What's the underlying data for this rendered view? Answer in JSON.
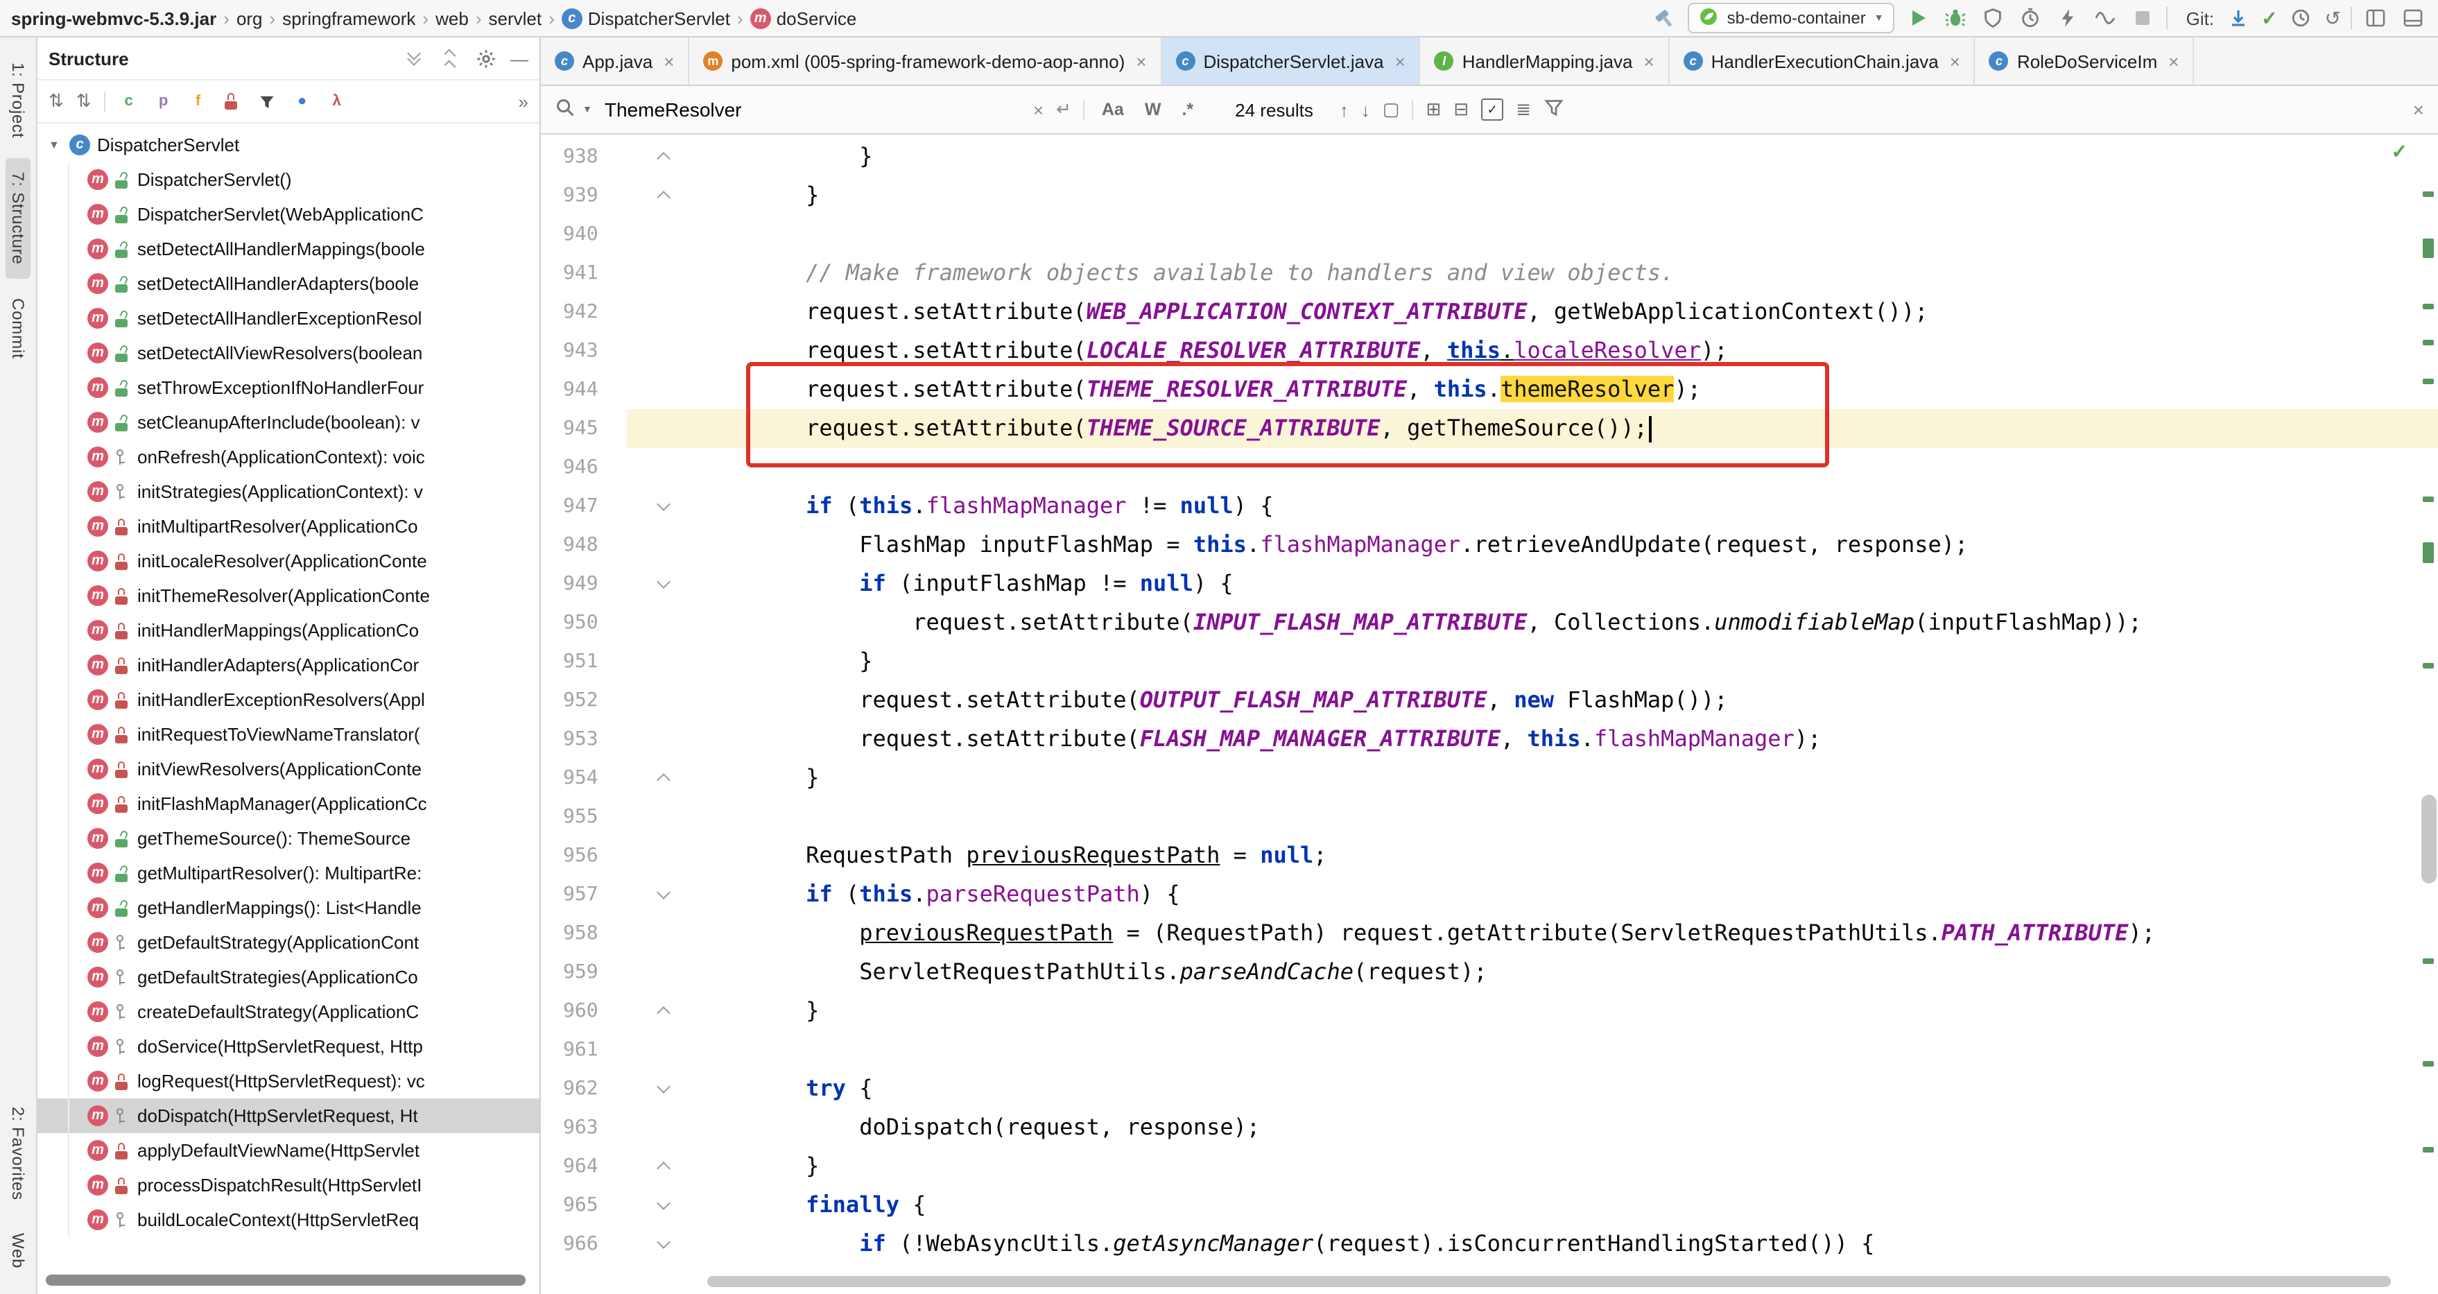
{
  "topbar": {
    "breadcrumbs": [
      {
        "label": "spring-webmvc-5.3.9.jar",
        "bold": true
      },
      {
        "label": "org"
      },
      {
        "label": "springframework"
      },
      {
        "label": "web"
      },
      {
        "label": "servlet"
      },
      {
        "label": "DispatcherServlet",
        "icon": "class"
      },
      {
        "label": "doService",
        "icon": "method"
      }
    ],
    "run_config": "sb-demo-container",
    "git_label": "Git:"
  },
  "stripe": {
    "top": [
      {
        "label": "1: Project"
      },
      {
        "label": "7: Structure",
        "active": true
      },
      {
        "label": "Commit"
      }
    ],
    "bottom": [
      {
        "label": "2: Favorites"
      },
      {
        "label": "Web"
      }
    ]
  },
  "structure": {
    "title": "Structure",
    "root": {
      "label": "DispatcherServlet"
    },
    "toolbar_chips": [
      {
        "glyph": "c",
        "color": "#59a869",
        "name": "show-anonymous-classes-toggle"
      },
      {
        "glyph": "p",
        "color": "#9876aa",
        "name": "show-properties-toggle"
      },
      {
        "glyph": "f",
        "color": "#e8a33d",
        "name": "show-fields-toggle"
      },
      {
        "type": "lock",
        "name": "show-non-public-toggle"
      },
      {
        "type": "funnel",
        "name": "group-methods-toggle"
      },
      {
        "glyph": "●",
        "color": "#3b82c4",
        "name": "sort-by-visibility-toggle"
      },
      {
        "glyph": "λ",
        "color": "#c75450",
        "name": "show-lambdas-toggle"
      }
    ],
    "items": [
      {
        "label": "DispatcherServlet()",
        "vis": "public"
      },
      {
        "label": "DispatcherServlet(WebApplicationC",
        "vis": "public"
      },
      {
        "label": "setDetectAllHandlerMappings(boole",
        "vis": "public"
      },
      {
        "label": "setDetectAllHandlerAdapters(boole",
        "vis": "public"
      },
      {
        "label": "setDetectAllHandlerExceptionResol",
        "vis": "public"
      },
      {
        "label": "setDetectAllViewResolvers(boolean",
        "vis": "public"
      },
      {
        "label": "setThrowExceptionIfNoHandlerFour",
        "vis": "public"
      },
      {
        "label": "setCleanupAfterInclude(boolean): v",
        "vis": "public"
      },
      {
        "label": "onRefresh(ApplicationContext): voic",
        "vis": "protected"
      },
      {
        "label": "initStrategies(ApplicationContext): v",
        "vis": "protected"
      },
      {
        "label": "initMultipartResolver(ApplicationCo",
        "vis": "private"
      },
      {
        "label": "initLocaleResolver(ApplicationConte",
        "vis": "private"
      },
      {
        "label": "initThemeResolver(ApplicationConte",
        "vis": "private"
      },
      {
        "label": "initHandlerMappings(ApplicationCo",
        "vis": "private"
      },
      {
        "label": "initHandlerAdapters(ApplicationCor",
        "vis": "private"
      },
      {
        "label": "initHandlerExceptionResolvers(Appl",
        "vis": "private"
      },
      {
        "label": "initRequestToViewNameTranslator(",
        "vis": "private"
      },
      {
        "label": "initViewResolvers(ApplicationConte",
        "vis": "private"
      },
      {
        "label": "initFlashMapManager(ApplicationCc",
        "vis": "private"
      },
      {
        "label": "getThemeSource(): ThemeSource",
        "vis": "public"
      },
      {
        "label": "getMultipartResolver(): MultipartRe:",
        "vis": "public"
      },
      {
        "label": "getHandlerMappings(): List<Handle",
        "vis": "public"
      },
      {
        "label": "getDefaultStrategy(ApplicationCont",
        "vis": "protected"
      },
      {
        "label": "getDefaultStrategies(ApplicationCo",
        "vis": "protected"
      },
      {
        "label": "createDefaultStrategy(ApplicationC",
        "vis": "protected"
      },
      {
        "label": "doService(HttpServletRequest, Http",
        "vis": "protected"
      },
      {
        "label": "logRequest(HttpServletRequest): vc",
        "vis": "private"
      },
      {
        "label": "doDispatch(HttpServletRequest, Ht",
        "vis": "protected",
        "selected": true
      },
      {
        "label": "applyDefaultViewName(HttpServlet",
        "vis": "private"
      },
      {
        "label": "processDispatchResult(HttpServletI",
        "vis": "private"
      },
      {
        "label": "buildLocaleContext(HttpServletReq",
        "vis": "protected"
      }
    ]
  },
  "editor": {
    "tabs": [
      {
        "label": "App.java",
        "icon": "class"
      },
      {
        "label": "pom.xml (005-spring-framework-demo-aop-anno)",
        "icon": "maven"
      },
      {
        "label": "DispatcherServlet.java",
        "icon": "class",
        "active": true
      },
      {
        "label": "HandlerMapping.java",
        "icon": "interface"
      },
      {
        "label": "HandlerExecutionChain.java",
        "icon": "class"
      },
      {
        "label": "RoleDoServiceIm",
        "icon": "class"
      }
    ],
    "find": {
      "query": "ThemeResolver",
      "results": "24 results"
    },
    "code": {
      "lines": [
        {
          "n": 938,
          "fold": "up",
          "seg": [
            [
              "p",
              "            }"
            ]
          ]
        },
        {
          "n": 939,
          "fold": "up",
          "seg": [
            [
              "p",
              "        }"
            ]
          ]
        },
        {
          "n": 940,
          "seg": []
        },
        {
          "n": 941,
          "seg": [
            [
              "p",
              "        "
            ],
            [
              "cm",
              "// Make framework objects available to handlers and view objects."
            ]
          ]
        },
        {
          "n": 942,
          "seg": [
            [
              "p",
              "        request.setAttribute("
            ],
            [
              "cn",
              "WEB_APPLICATION_CONTEXT_ATTRIBUTE"
            ],
            [
              "p",
              ", getWebApplicationContext());"
            ]
          ]
        },
        {
          "n": 943,
          "seg": [
            [
              "p",
              "        request.setAttribute("
            ],
            [
              "cn",
              "LOCALE_RESOLVER_ATTRIBUTE"
            ],
            [
              "p",
              ", "
            ],
            [
              "ku",
              "this"
            ],
            [
              "pu",
              "."
            ],
            [
              "fu",
              "localeResolver"
            ],
            [
              "p",
              ");"
            ]
          ]
        },
        {
          "n": 944,
          "seg": [
            [
              "p",
              "        request.setAttribute("
            ],
            [
              "cn",
              "THEME_RESOLVER_ATTRIBUTE"
            ],
            [
              "p",
              ", "
            ],
            [
              "k",
              "this"
            ],
            [
              "p",
              "."
            ],
            [
              "hl",
              "themeResolver"
            ],
            [
              "p",
              ");"
            ]
          ]
        },
        {
          "n": 945,
          "cur": true,
          "caret": true,
          "seg": [
            [
              "p",
              "        request.setAttribute("
            ],
            [
              "cn",
              "THEME_SOURCE_ATTRIBUTE"
            ],
            [
              "p",
              ", getThemeSource());"
            ]
          ]
        },
        {
          "n": 946,
          "seg": []
        },
        {
          "n": 947,
          "fold": "v",
          "seg": [
            [
              "p",
              "        "
            ],
            [
              "k",
              "if"
            ],
            [
              "p",
              " ("
            ],
            [
              "k",
              "this"
            ],
            [
              "p",
              "."
            ],
            [
              "f",
              "flashMapManager"
            ],
            [
              "p",
              " != "
            ],
            [
              "k",
              "null"
            ],
            [
              "p",
              ") {"
            ]
          ]
        },
        {
          "n": 948,
          "seg": [
            [
              "p",
              "            FlashMap inputFlashMap = "
            ],
            [
              "k",
              "this"
            ],
            [
              "p",
              "."
            ],
            [
              "f",
              "flashMapManager"
            ],
            [
              "p",
              ".retrieveAndUpdate(request, response);"
            ]
          ]
        },
        {
          "n": 949,
          "fold": "v",
          "seg": [
            [
              "p",
              "            "
            ],
            [
              "k",
              "if"
            ],
            [
              "p",
              " (inputFlashMap != "
            ],
            [
              "k",
              "null"
            ],
            [
              "p",
              ") {"
            ]
          ]
        },
        {
          "n": 950,
          "seg": [
            [
              "p",
              "                request.setAttribute("
            ],
            [
              "cn",
              "INPUT_FLASH_MAP_ATTRIBUTE"
            ],
            [
              "p",
              ", Collections."
            ],
            [
              "sm",
              "unmodifiableMap"
            ],
            [
              "p",
              "(inputFlashMap));"
            ]
          ]
        },
        {
          "n": 951,
          "seg": [
            [
              "p",
              "            }"
            ]
          ]
        },
        {
          "n": 952,
          "seg": [
            [
              "p",
              "            request.setAttribute("
            ],
            [
              "cn",
              "OUTPUT_FLASH_MAP_ATTRIBUTE"
            ],
            [
              "p",
              ", "
            ],
            [
              "k",
              "new"
            ],
            [
              "p",
              " FlashMap());"
            ]
          ]
        },
        {
          "n": 953,
          "seg": [
            [
              "p",
              "            request.setAttribute("
            ],
            [
              "cn",
              "FLASH_MAP_MANAGER_ATTRIBUTE"
            ],
            [
              "p",
              ", "
            ],
            [
              "k",
              "this"
            ],
            [
              "p",
              "."
            ],
            [
              "f",
              "flashMapManager"
            ],
            [
              "p",
              ");"
            ]
          ]
        },
        {
          "n": 954,
          "fold": "up",
          "seg": [
            [
              "p",
              "        }"
            ]
          ]
        },
        {
          "n": 955,
          "seg": []
        },
        {
          "n": 956,
          "seg": [
            [
              "p",
              "        RequestPath "
            ],
            [
              "u",
              "previousRequestPath"
            ],
            [
              "p",
              " = "
            ],
            [
              "k",
              "null"
            ],
            [
              "p",
              ";"
            ]
          ]
        },
        {
          "n": 957,
          "fold": "v",
          "seg": [
            [
              "p",
              "        "
            ],
            [
              "k",
              "if"
            ],
            [
              "p",
              " ("
            ],
            [
              "k",
              "this"
            ],
            [
              "p",
              "."
            ],
            [
              "f",
              "parseRequestPath"
            ],
            [
              "p",
              ") {"
            ]
          ]
        },
        {
          "n": 958,
          "seg": [
            [
              "p",
              "            "
            ],
            [
              "u",
              "previousRequestPath"
            ],
            [
              "p",
              " = (RequestPath) request.getAttribute(ServletRequestPathUtils."
            ],
            [
              "cn",
              "PATH_ATTRIBUTE"
            ],
            [
              "p",
              ");"
            ]
          ]
        },
        {
          "n": 959,
          "seg": [
            [
              "p",
              "            ServletRequestPathUtils."
            ],
            [
              "sm",
              "parseAndCache"
            ],
            [
              "p",
              "(request);"
            ]
          ]
        },
        {
          "n": 960,
          "fold": "up",
          "seg": [
            [
              "p",
              "        }"
            ]
          ]
        },
        {
          "n": 961,
          "seg": []
        },
        {
          "n": 962,
          "fold": "v",
          "seg": [
            [
              "p",
              "        "
            ],
            [
              "k",
              "try"
            ],
            [
              "p",
              " {"
            ]
          ]
        },
        {
          "n": 963,
          "seg": [
            [
              "p",
              "            doDispatch(request, response);"
            ]
          ]
        },
        {
          "n": 964,
          "fold": "up",
          "seg": [
            [
              "p",
              "        }"
            ]
          ]
        },
        {
          "n": 965,
          "fold": "v",
          "seg": [
            [
              "p",
              "        "
            ],
            [
              "k",
              "finally"
            ],
            [
              "p",
              " {"
            ]
          ]
        },
        {
          "n": 966,
          "fold": "v",
          "seg": [
            [
              "p",
              "            "
            ],
            [
              "k",
              "if"
            ],
            [
              "p",
              " (!WebAsyncUtils."
            ],
            [
              "sm",
              "getAsyncManager"
            ],
            [
              "p",
              "(request).isConcurrentHandlingStarted()) {"
            ]
          ]
        }
      ]
    }
  },
  "icons": {
    "breadcrumb_separator": "›",
    "caret_down": "▼",
    "check": "✓",
    "undo": "↺",
    "newline": "↵",
    "close": "×",
    "arrow_up": "↑",
    "arrow_down": "↓",
    "match_case": "Aa",
    "words": "W",
    "regex": ".*",
    "chevrons": "»",
    "add_box": "⊞",
    "remove_box": "⊟",
    "multiline": "≣",
    "sort_alpha": "⇅",
    "sort_vis": "⇅",
    "minimize": "—",
    "open_square": "▢"
  },
  "colors": {
    "annotation_red": "#df3126",
    "search_highlight": "#ffd83d",
    "current_line": "#fbf5d8",
    "selection_grey": "#d4d4d4",
    "run_green": "#59a869",
    "keyword_blue": "#0033b3",
    "member_purple": "#871094"
  }
}
